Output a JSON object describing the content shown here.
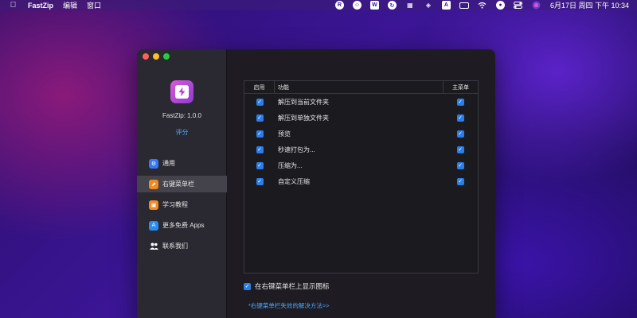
{
  "menubar": {
    "apple_icon": "apple-icon",
    "app_name": "FastZip",
    "menus": [
      "编辑",
      "窗口"
    ],
    "status_icons": [
      "r-icon",
      "emoji-icon",
      "w-icon",
      "sync-icon",
      "grid-icon",
      "layers-icon",
      "a-icon",
      "battery-icon",
      "wifi-icon",
      "user-icon",
      "control-center-icon",
      "siri-icon"
    ],
    "clock": "6月17日 周四 下午 10:34"
  },
  "window": {
    "app_version": "FastZip: 1.0.0",
    "rate_label": "评分",
    "nav": [
      {
        "label": "通用",
        "icon": "gear-icon",
        "color": "#3478f6",
        "active": false
      },
      {
        "label": "右键菜单栏",
        "icon": "cursor-icon",
        "color": "#f08a24",
        "active": true
      },
      {
        "label": "学习教程",
        "icon": "book-icon",
        "color": "#f08a24",
        "active": false
      },
      {
        "label": "更多免费 Apps",
        "icon": "appstore-icon",
        "color": "#2b8cf0",
        "active": false
      },
      {
        "label": "联系我们",
        "icon": "people-icon",
        "color": "#5a5a66",
        "active": false
      }
    ],
    "table": {
      "headers": {
        "enable": "启用",
        "function": "功能",
        "main_menu": "主菜单"
      },
      "rows": [
        {
          "label": "解压到当前文件夹",
          "enabled": true,
          "main": true
        },
        {
          "label": "解压到单独文件夹",
          "enabled": true,
          "main": true
        },
        {
          "label": "预览",
          "enabled": true,
          "main": true
        },
        {
          "label": "秒速打包为...",
          "enabled": true,
          "main": true
        },
        {
          "label": "压缩为...",
          "enabled": true,
          "main": true
        },
        {
          "label": "自定义压缩",
          "enabled": true,
          "main": true
        }
      ]
    },
    "show_icon_label": "在右键菜单栏上显示图标",
    "show_icon_checked": true,
    "help_link": "*右键菜单栏失效的解决方法>>"
  },
  "colors": {
    "accent": "#2b7de9",
    "link": "#4aa8ff"
  }
}
